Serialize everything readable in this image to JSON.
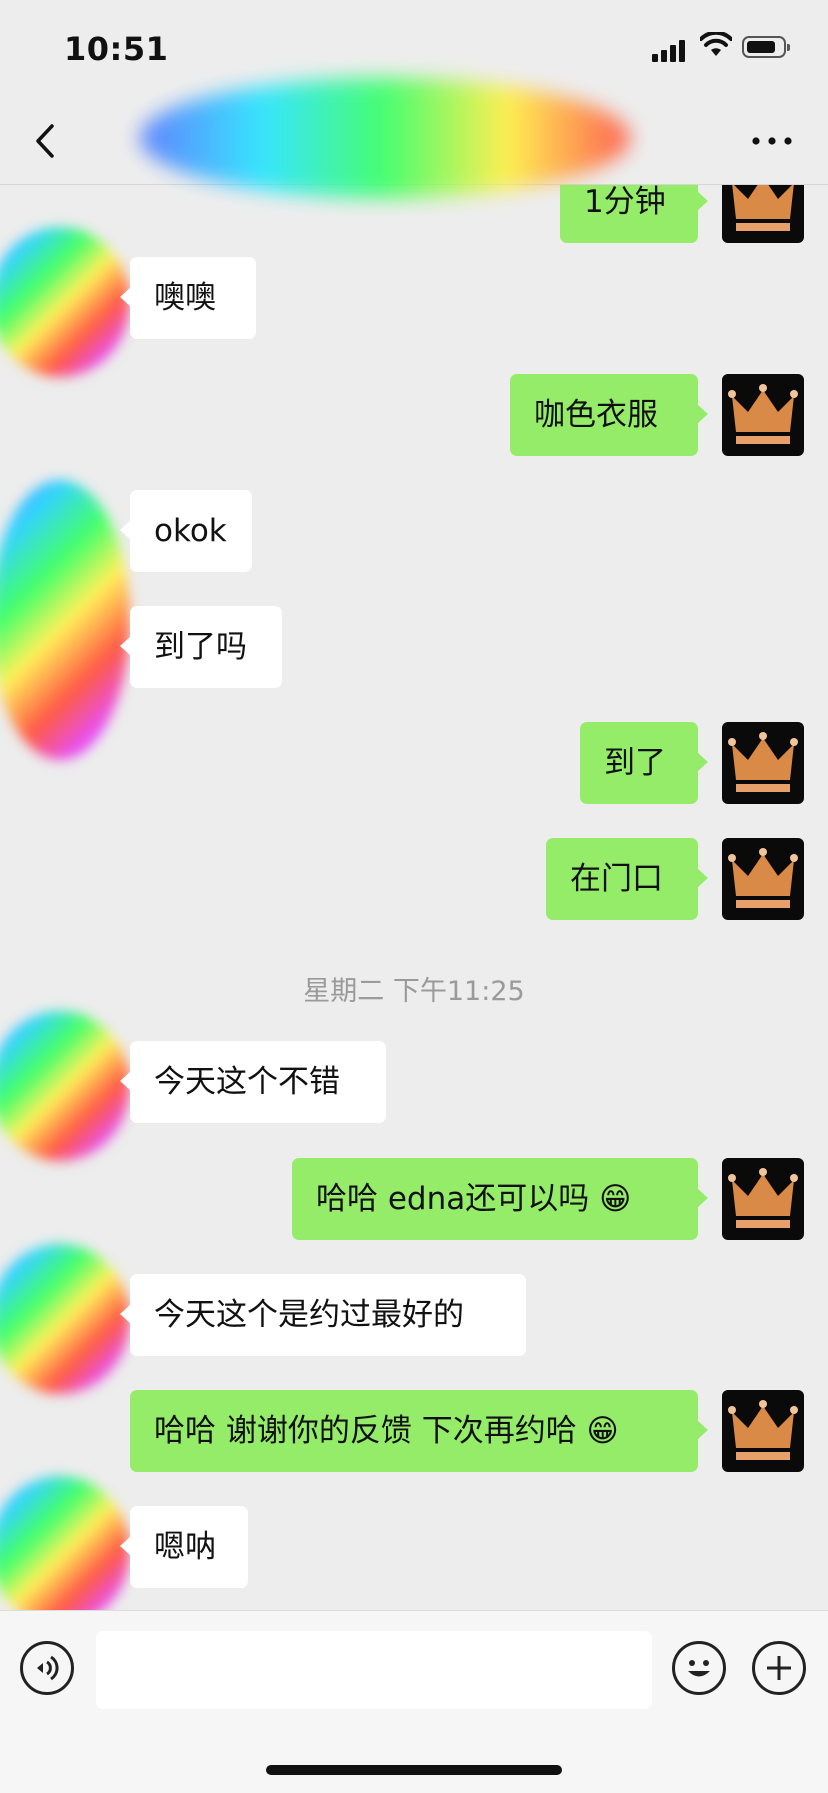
{
  "status_bar": {
    "time": "10:51"
  },
  "nav": {
    "title": ""
  },
  "messages": [
    {
      "side": "out",
      "text": "1分钟",
      "partial": true
    },
    {
      "side": "in",
      "text": "噢噢"
    },
    {
      "side": "out",
      "text": "咖色衣服"
    },
    {
      "side": "in",
      "text": "okok"
    },
    {
      "side": "in",
      "text": "到了吗"
    },
    {
      "side": "out",
      "text": "到了"
    },
    {
      "side": "out",
      "text": "在门口"
    },
    {
      "side": "in",
      "text": "今天这个不错"
    },
    {
      "side": "out",
      "text": "哈哈 edna还可以吗 😁"
    },
    {
      "side": "in",
      "text": "今天这个是约过最好的"
    },
    {
      "side": "out",
      "text": "哈哈 谢谢你的反馈 下次再约哈 😁"
    },
    {
      "side": "in",
      "text": "嗯呐"
    }
  ],
  "timestamp": "星期二 下午11:25",
  "input": {
    "value": "",
    "placeholder": ""
  },
  "icons": {
    "back": "chevron-left-icon",
    "more": "more-icon",
    "voice": "voice-icon",
    "emoji": "emoji-icon",
    "plus": "plus-icon"
  },
  "colors": {
    "outgoing_bubble": "#95ec69",
    "incoming_bubble": "#ffffff",
    "background": "#ededed"
  }
}
